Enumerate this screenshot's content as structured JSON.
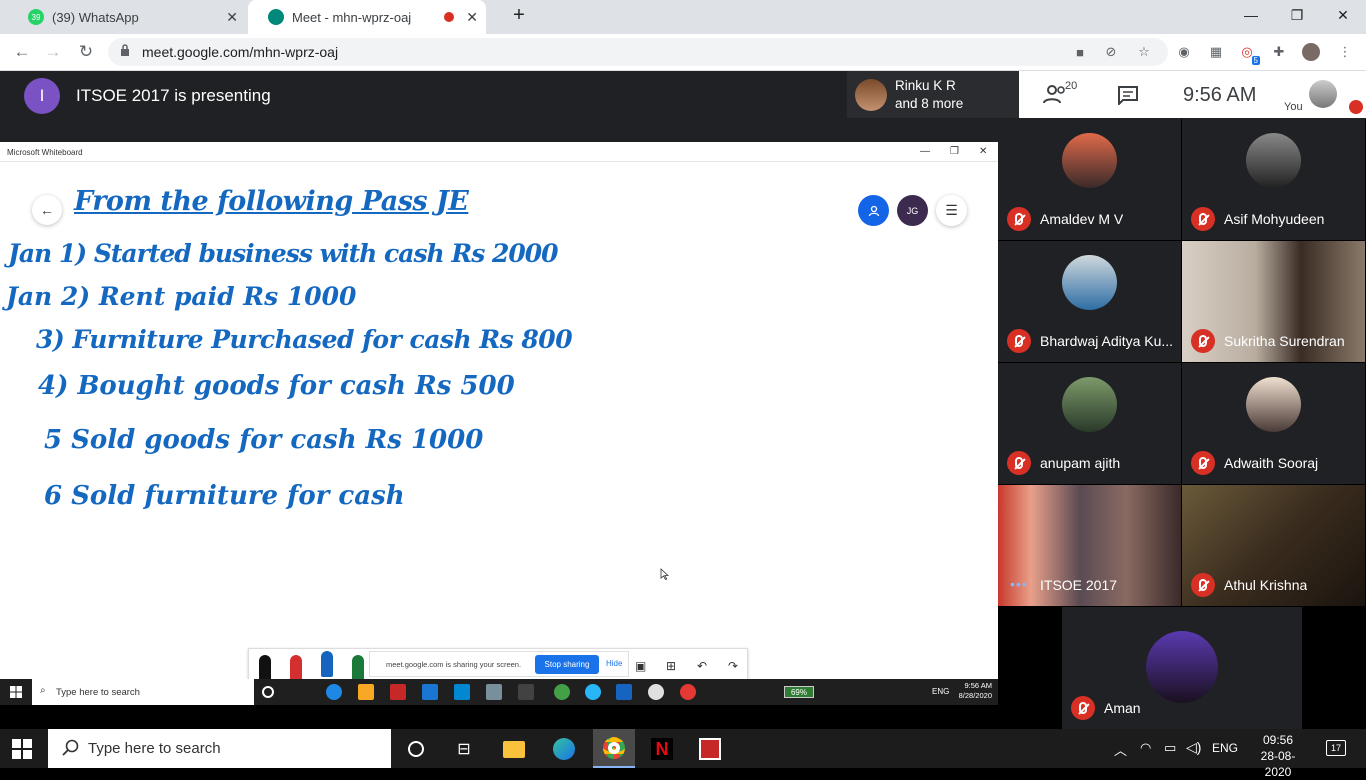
{
  "browser": {
    "tabs": [
      {
        "title": "(39) WhatsApp",
        "badge": "39"
      },
      {
        "title": "Meet - mhn-wprz-oaj"
      }
    ],
    "url": "meet.google.com/mhn-wprz-oaj",
    "extension_badge": "5"
  },
  "meet": {
    "presenter_initial": "I",
    "presenting_text": "ITSOE 2017 is presenting",
    "people_line1": "Rinku K R",
    "people_line2": "and 8 more",
    "participant_count": "20",
    "clock": "9:56  AM",
    "you_label": "You"
  },
  "whiteboard": {
    "window_title": "Microsoft Whiteboard",
    "user_initials": "JG",
    "lines": [
      "From the following Pass JE",
      "Jan 1) Started business with cash Rs 2000",
      "Jan 2) Rent paid Rs 1000",
      "3) Furniture Purchased for cash Rs 800",
      "4) Bought goods for cash Rs 500",
      "5  Sold goods for cash Rs 1000",
      "6  Sold furniture for cash"
    ],
    "share_text": "meet.google.com is sharing your screen.",
    "stop_sharing": "Stop sharing",
    "hide": "Hide"
  },
  "inner_taskbar": {
    "search": "Type here to search",
    "battery": "69%",
    "lang": "ENG",
    "time": "9:56 AM",
    "date": "8/28/2020"
  },
  "participants": [
    {
      "name": "Amaldev M V"
    },
    {
      "name": "Asif Mohyudeen"
    },
    {
      "name": "Bhardwaj Aditya Ku..."
    },
    {
      "name": "Sukritha Surendran"
    },
    {
      "name": "anupam ajith"
    },
    {
      "name": "Adwaith Sooraj"
    },
    {
      "name": "ITSOE 2017"
    },
    {
      "name": "Athul Krishna"
    },
    {
      "name": "Aman"
    }
  ],
  "taskbar": {
    "search": "Type here to search",
    "lang": "ENG",
    "time": "09:56",
    "date": "28-08-2020",
    "notifications": "17"
  },
  "colors": {
    "meet_dark": "#202124",
    "mic_off_red": "#d93025",
    "ink_blue": "#1468c0",
    "stop_share_blue": "#1a73e8",
    "presenter_purple": "#7b52c4"
  }
}
